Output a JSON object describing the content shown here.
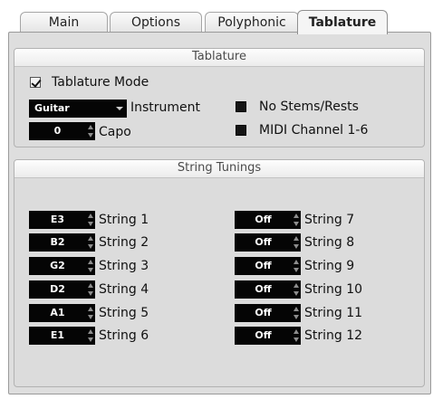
{
  "tabs": [
    {
      "label": "Main"
    },
    {
      "label": "Options"
    },
    {
      "label": "Polyphonic"
    },
    {
      "label": "Tablature"
    }
  ],
  "active_tab": "Tablature",
  "tablature": {
    "title": "Tablature",
    "mode_label": "Tablature Mode",
    "mode_checked": true,
    "instrument_value": "Guitar",
    "instrument_label": "Instrument",
    "capo_value": "0",
    "capo_label": "Capo",
    "no_stems_label": "No Stems/Rests",
    "no_stems_checked": false,
    "midi_channel_label": "MIDI Channel 1-6",
    "midi_channel_checked": false
  },
  "string_tunings": {
    "title": "String Tunings",
    "left": [
      {
        "value": "E3",
        "label": "String 1"
      },
      {
        "value": "B2",
        "label": "String 2"
      },
      {
        "value": "G2",
        "label": "String 3"
      },
      {
        "value": "D2",
        "label": "String 4"
      },
      {
        "value": "A1",
        "label": "String 5"
      },
      {
        "value": "E1",
        "label": "String 6"
      }
    ],
    "right": [
      {
        "value": "Off",
        "label": "String 7"
      },
      {
        "value": "Off",
        "label": "String 8"
      },
      {
        "value": "Off",
        "label": "String 9"
      },
      {
        "value": "Off",
        "label": "String 10"
      },
      {
        "value": "Off",
        "label": "String 11"
      },
      {
        "value": "Off",
        "label": "String 12"
      }
    ]
  },
  "colors": {
    "panel_bg": "#dedede",
    "field_bg": "#050505",
    "field_text": "#ffffff"
  }
}
